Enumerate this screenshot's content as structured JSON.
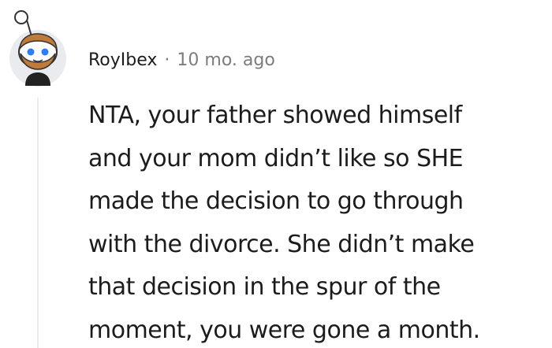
{
  "comment": {
    "author": "RoyIbex",
    "separator": "·",
    "timestamp": "10 mo. ago",
    "avatar_icon": "snoo-avatar-icon",
    "body_lines": [
      "NTA, your father showed himself",
      "and your mom didn’t like so SHE",
      "made the decision to go through",
      "with the divorce. She didn’t make",
      "that decision in the spur of the",
      "moment, you were gone a month."
    ]
  },
  "colors": {
    "author_text": "#1c1c1c",
    "meta_text": "#7c7c7c",
    "avatar_bg": "#e9ebee",
    "beard": "#c07a3a",
    "eyes": "#2f7df6",
    "thread_line": "#e9ebed"
  }
}
